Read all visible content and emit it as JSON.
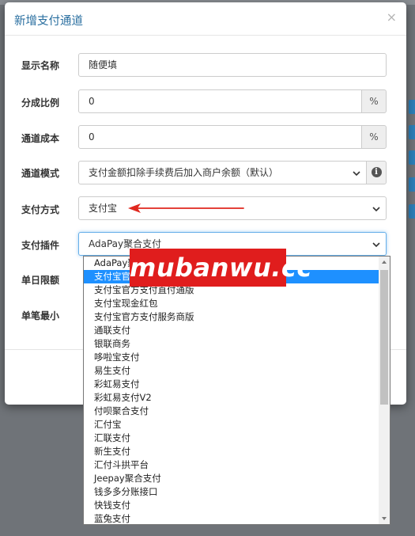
{
  "modal": {
    "title": "新增支付通道",
    "close": "×"
  },
  "form": {
    "display_name": {
      "label": "显示名称",
      "value": "随便填"
    },
    "split_ratio": {
      "label": "分成比例",
      "value": "0",
      "unit": "%"
    },
    "channel_cost": {
      "label": "通道成本",
      "value": "0",
      "unit": "%"
    },
    "channel_mode": {
      "label": "通道模式",
      "value": "支付金额扣除手续费后加入商户余额（默认）",
      "info": "i"
    },
    "payment_method": {
      "label": "支付方式",
      "value": "支付宝"
    },
    "payment_plugin": {
      "label": "支付插件",
      "value": "AdaPay聚合支付"
    },
    "daily_limit": {
      "label": "单日限额"
    },
    "min_single": {
      "label": "单笔最小"
    }
  },
  "dropdown": {
    "selected_index": 1,
    "options": [
      "AdaPay聚合支付",
      "支付宝官方支付",
      "支付宝官方支付直付通版",
      "支付宝现金红包",
      "支付宝官方支付服务商版",
      "通联支付",
      "银联商务",
      "哆啦宝支付",
      "易生支付",
      "彩虹易支付",
      "彩虹易支付V2",
      "付呗聚合支付",
      "汇付宝",
      "汇联支付",
      "新生支付",
      "汇付斗拱平台",
      "Jeepay聚合支付",
      "钱多多分账接口",
      "快钱支付",
      "蓝兔支付"
    ]
  },
  "watermark": {
    "text": "mubanwu.cc"
  },
  "colors": {
    "title": "#2a6fa0",
    "selected": "#1e90ff",
    "arrow": "#e0281f",
    "watermark": "#e01d1d"
  }
}
